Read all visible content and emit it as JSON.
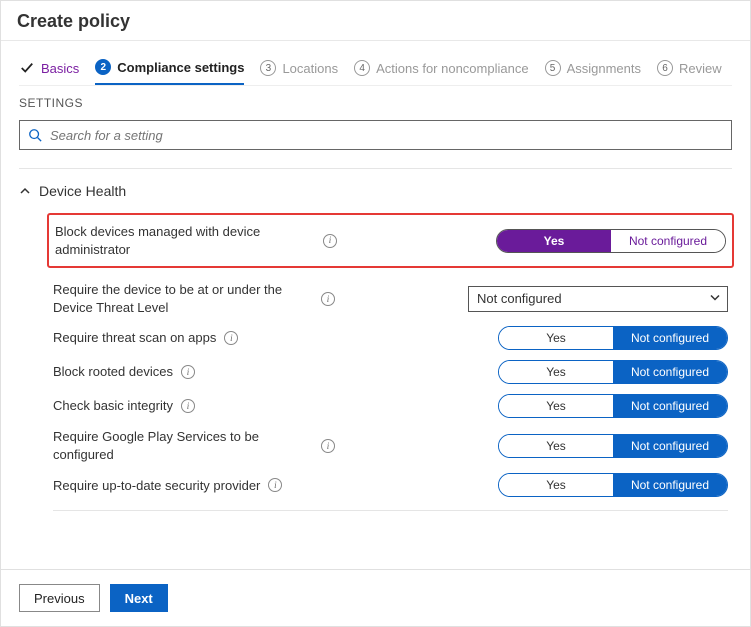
{
  "header": {
    "title": "Create policy"
  },
  "steps": [
    {
      "label": "Basics",
      "state": "done"
    },
    {
      "label": "Compliance settings",
      "state": "active"
    },
    {
      "label": "Locations",
      "state": "todo"
    },
    {
      "label": "Actions for noncompliance",
      "state": "todo"
    },
    {
      "label": "Assignments",
      "state": "todo"
    },
    {
      "label": "Review",
      "state": "todo"
    }
  ],
  "settings_label": "SETTINGS",
  "search": {
    "placeholder": "Search for a setting"
  },
  "section": {
    "title": "Device Health",
    "rows": [
      {
        "label": "Block devices managed with device administrator",
        "control": "pill-purple",
        "opts": [
          "Yes",
          "Not configured"
        ],
        "selected": 0
      },
      {
        "label": "Require the device to be at or under the Device Threat Level",
        "control": "select",
        "value": "Not configured"
      },
      {
        "label": "Require threat scan on apps",
        "control": "pill-blue",
        "opts": [
          "Yes",
          "Not configured"
        ],
        "selected": 1
      },
      {
        "label": "Block rooted devices",
        "control": "pill-blue",
        "opts": [
          "Yes",
          "Not configured"
        ],
        "selected": 1
      },
      {
        "label": "Check basic integrity",
        "control": "pill-blue",
        "opts": [
          "Yes",
          "Not configured"
        ],
        "selected": 1
      },
      {
        "label": "Require Google Play Services to be configured",
        "control": "pill-blue",
        "opts": [
          "Yes",
          "Not configured"
        ],
        "selected": 1
      },
      {
        "label": "Require up-to-date security provider",
        "control": "pill-blue",
        "opts": [
          "Yes",
          "Not configured"
        ],
        "selected": 1
      }
    ]
  },
  "footer": {
    "prev": "Previous",
    "next": "Next"
  }
}
